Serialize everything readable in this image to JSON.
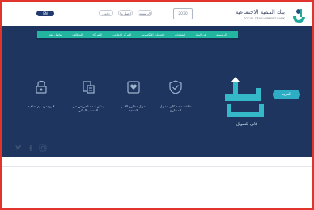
{
  "header": {
    "brand_name": "بنك التنمية الاجتماعية",
    "brand_sub": "SOCIAL DEVELOPMENT BANK",
    "vision_badge": "2030",
    "lang_button": "EN",
    "links": [
      "الرئيسية",
      "اتصل بنا",
      "دخول"
    ]
  },
  "nav": {
    "items": [
      "الرئيسية",
      "عن البنك",
      "المنتجات",
      "الخدمات الإلكترونية",
      "المركز الإعلامي",
      "الشركاء",
      "الوظائف",
      "تواصل معنا"
    ]
  },
  "hero": {
    "glyph_caption": "كاف للتمويل",
    "cta_label": "المزيد",
    "features": [
      {
        "label": "شاشة منصة كاف لتمويل المشاريع",
        "icon": "shield-check-icon"
      },
      {
        "label": "تمويل مشاريع الأسر المنتجة",
        "icon": "heart-card-icon"
      },
      {
        "label": "يمكن سداد القروض عبر الحساب البنكي",
        "icon": "document-link-icon"
      },
      {
        "label": "لا يوجد رسوم إضافية",
        "icon": "lock-person-icon"
      }
    ]
  },
  "social": [
    "twitter-icon",
    "facebook-icon",
    "instagram-icon"
  ],
  "colors": {
    "navy": "#1d355f",
    "teal": "#22b5a0",
    "accent": "#2eaec4",
    "frame": "#e0342c"
  }
}
